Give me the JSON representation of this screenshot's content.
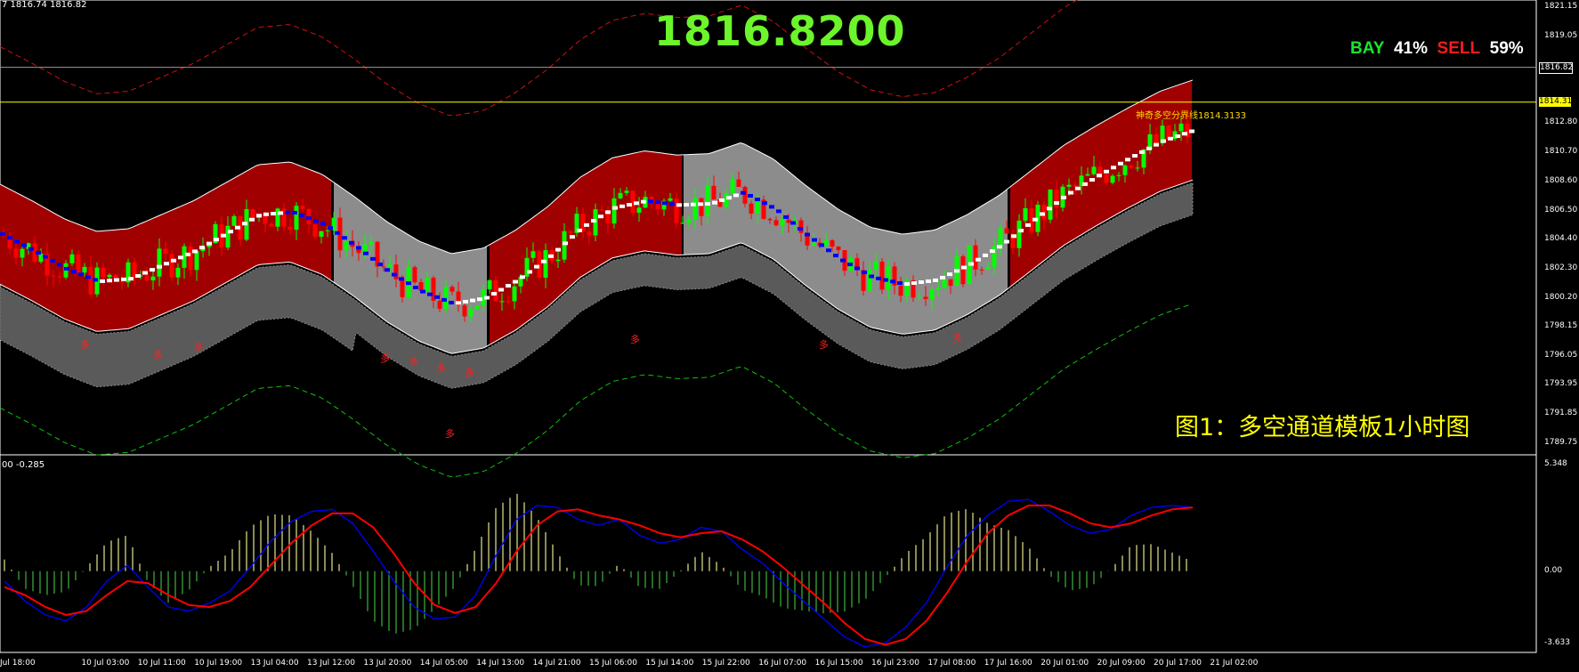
{
  "header": {
    "ohlc_text": "7 1816.74 1816.82",
    "macd_text": "00 -0.285",
    "big_price": "1816.8200",
    "bay_label": "BAY",
    "bay_pct": "41%",
    "sell_label": "SELL",
    "sell_pct": "59%",
    "caption": "图1：多空通道模板1小时图",
    "annotation": "神奇多空分界线1814.3133"
  },
  "colors": {
    "background": "#000000",
    "bull_candle": "#00ff00",
    "bear_candle": "#ff0000",
    "bull_channel": "#a00000",
    "bear_channel": "#8c8c8c",
    "up_trendline": "#ffffff",
    "down_trendline": "#0000ff",
    "macd_line": "#0000ff",
    "signal_line": "#ff0000",
    "price_line": "#ffff00"
  },
  "chart_data": [
    {
      "type": "candlestick",
      "title": "",
      "y_ticks": [
        "1821.15",
        "1819.05",
        "1816.82",
        "1814.31",
        "1812.80",
        "1810.70",
        "1808.60",
        "1806.50",
        "1804.40",
        "1802.30",
        "1800.20",
        "1798.15",
        "1796.05",
        "1793.95",
        "1791.85",
        "1789.75"
      ],
      "highlight_price": "1816.82",
      "highlight_line": "1814.31",
      "ylim": [
        1789.75,
        1821.15
      ],
      "marker_text": "多",
      "x_ticks": [
        "Jul 18:00",
        "10 Jul 03:00",
        "10 Jul 11:00",
        "10 Jul 19:00",
        "13 Jul 04:00",
        "13 Jul 12:00",
        "13 Jul 20:00",
        "14 Jul 05:00",
        "14 Jul 13:00",
        "14 Jul 21:00",
        "15 Jul 06:00",
        "15 Jul 14:00",
        "15 Jul 22:00",
        "16 Jul 07:00",
        "16 Jul 15:00",
        "16 Jul 23:00",
        "17 Jul 08:00",
        "17 Jul 16:00",
        "20 Jul 01:00",
        "20 Jul 09:00",
        "20 Jul 17:00",
        "21 Jul 02:00"
      ],
      "midline": [
        1804.8,
        1803.6,
        1802.3,
        1801.4,
        1801.6,
        1802.6,
        1803.6,
        1804.9,
        1806.2,
        1806.4,
        1805.5,
        1803.9,
        1802.1,
        1800.7,
        1799.8,
        1800.2,
        1801.5,
        1803.2,
        1805.3,
        1806.7,
        1807.2,
        1806.9,
        1807.0,
        1807.8,
        1806.6,
        1804.7,
        1803.0,
        1801.7,
        1801.2,
        1801.5,
        1802.6,
        1804.0,
        1805.8,
        1807.6,
        1809.0,
        1810.3,
        1811.5,
        1812.3
      ],
      "channel_halfwidth": 3.6
    },
    {
      "type": "macd",
      "y_ticks": [
        "5.348",
        "0.00",
        "-3.633"
      ],
      "ylim": [
        -3.633,
        5.348
      ],
      "macd": [
        -0.5,
        -1.5,
        -2.2,
        -2.5,
        -1.8,
        -0.5,
        0.3,
        -0.8,
        -1.8,
        -2.0,
        -1.6,
        -1.0,
        0.2,
        1.5,
        2.5,
        3.0,
        3.1,
        2.4,
        1.0,
        -0.5,
        -1.8,
        -2.4,
        -2.3,
        -1.2,
        0.8,
        2.6,
        3.3,
        3.2,
        2.6,
        2.3,
        2.6,
        1.8,
        1.4,
        1.6,
        2.2,
        2.0,
        1.1,
        0.4,
        -0.6,
        -1.5,
        -2.4,
        -3.3,
        -3.8,
        -3.6,
        -2.8,
        -1.6,
        0.2,
        1.8,
        2.8,
        3.5,
        3.6,
        3.0,
        2.3,
        1.9,
        2.1,
        2.8,
        3.2,
        3.3,
        3.2
      ],
      "signal": [
        -0.8,
        -1.2,
        -1.8,
        -2.2,
        -2.0,
        -1.2,
        -0.5,
        -0.6,
        -1.2,
        -1.7,
        -1.8,
        -1.5,
        -0.8,
        0.3,
        1.4,
        2.3,
        2.9,
        2.9,
        2.2,
        0.9,
        -0.6,
        -1.7,
        -2.1,
        -1.8,
        -0.6,
        1.0,
        2.3,
        3.0,
        3.1,
        2.8,
        2.6,
        2.3,
        1.9,
        1.7,
        1.9,
        2.0,
        1.6,
        1.0,
        0.2,
        -0.7,
        -1.6,
        -2.6,
        -3.4,
        -3.7,
        -3.4,
        -2.5,
        -1.1,
        0.5,
        1.9,
        2.8,
        3.3,
        3.3,
        2.9,
        2.4,
        2.2,
        2.4,
        2.8,
        3.1,
        3.2
      ]
    }
  ]
}
